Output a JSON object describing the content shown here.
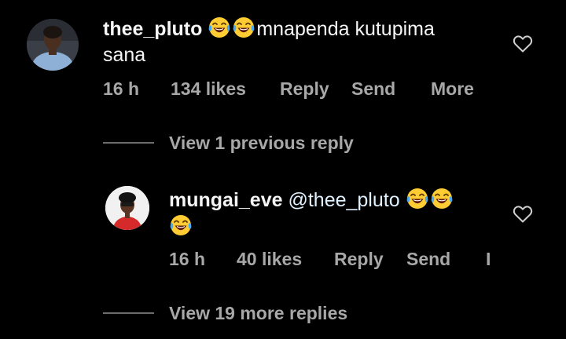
{
  "comment": {
    "username": "thee_pluto",
    "text_before": "",
    "emoji_count": 2,
    "emoji_name": "face-with-tears-of-joy-icon",
    "text_after": "mnapenda kutupima",
    "text_line2": "sana",
    "time": "16 h",
    "likes": "134 likes",
    "reply_label": "Reply",
    "send_label": "Send",
    "more_label": "More"
  },
  "view_previous": "View 1 previous reply",
  "reply": {
    "username": "mungai_eve",
    "mention": "@thee_pluto",
    "emoji_count_line1": 2,
    "emoji_count_line2": 1,
    "time": "16 h",
    "likes": "40 likes",
    "reply_label": "Reply",
    "send_label": "Send",
    "more_label_truncated": "I"
  },
  "view_more": "View 19 more replies",
  "colors": {
    "background": "#000000",
    "text": "#f5f5f5",
    "muted": "#a8a8a8",
    "divider": "#6b6b6b",
    "emoji_face": "#ffcc33"
  }
}
